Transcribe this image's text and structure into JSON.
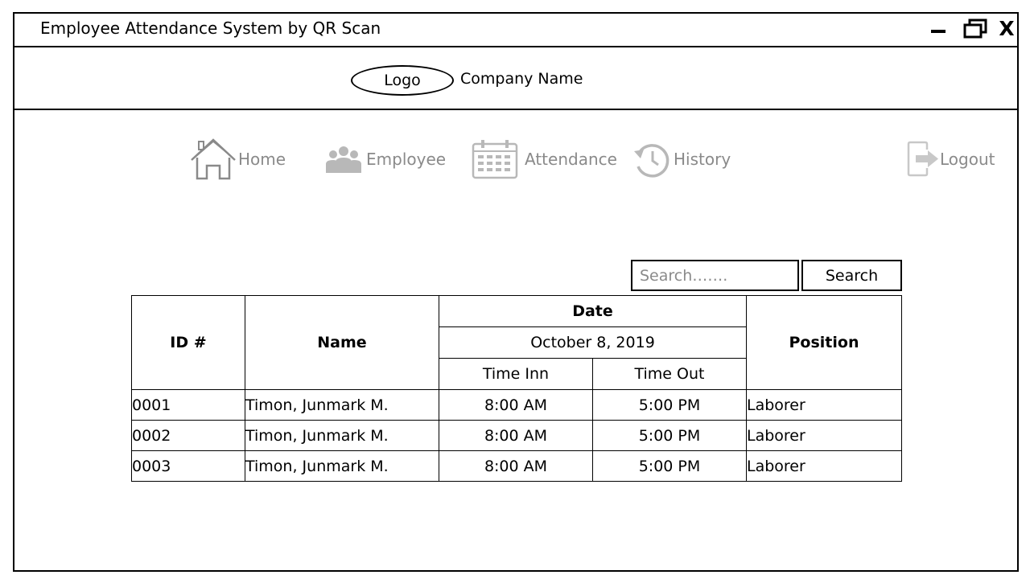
{
  "window": {
    "title": "Employee Attendance System by QR Scan",
    "close_label": "X"
  },
  "header": {
    "logo_label": "Logo",
    "company_name": "Company Name"
  },
  "nav": {
    "items": [
      {
        "label": "Home",
        "icon": "home-icon"
      },
      {
        "label": "Employee",
        "icon": "employees-icon"
      },
      {
        "label": "Attendance",
        "icon": "calendar-icon"
      },
      {
        "label": "History",
        "icon": "history-icon"
      },
      {
        "label": "Logout",
        "icon": "logout-icon"
      }
    ],
    "color": "#8a8a8a"
  },
  "search": {
    "placeholder": "Search…….",
    "button_label": "Search"
  },
  "table": {
    "headers": {
      "id": "ID #",
      "name": "Name",
      "date": "Date",
      "date_value": "October 8, 2019",
      "time_in": "Time Inn",
      "time_out": "Time Out",
      "position": "Position"
    },
    "rows": [
      {
        "id": "0001",
        "name": "Timon, Junmark M.",
        "time_in": "8:00 AM",
        "time_out": "5:00 PM",
        "position": "Laborer"
      },
      {
        "id": "0002",
        "name": "Timon, Junmark M.",
        "time_in": "8:00 AM",
        "time_out": "5:00 PM",
        "position": "Laborer"
      },
      {
        "id": "0003",
        "name": "Timon, Junmark M.",
        "time_in": "8:00 AM",
        "time_out": "5:00 PM",
        "position": "Laborer"
      }
    ]
  }
}
